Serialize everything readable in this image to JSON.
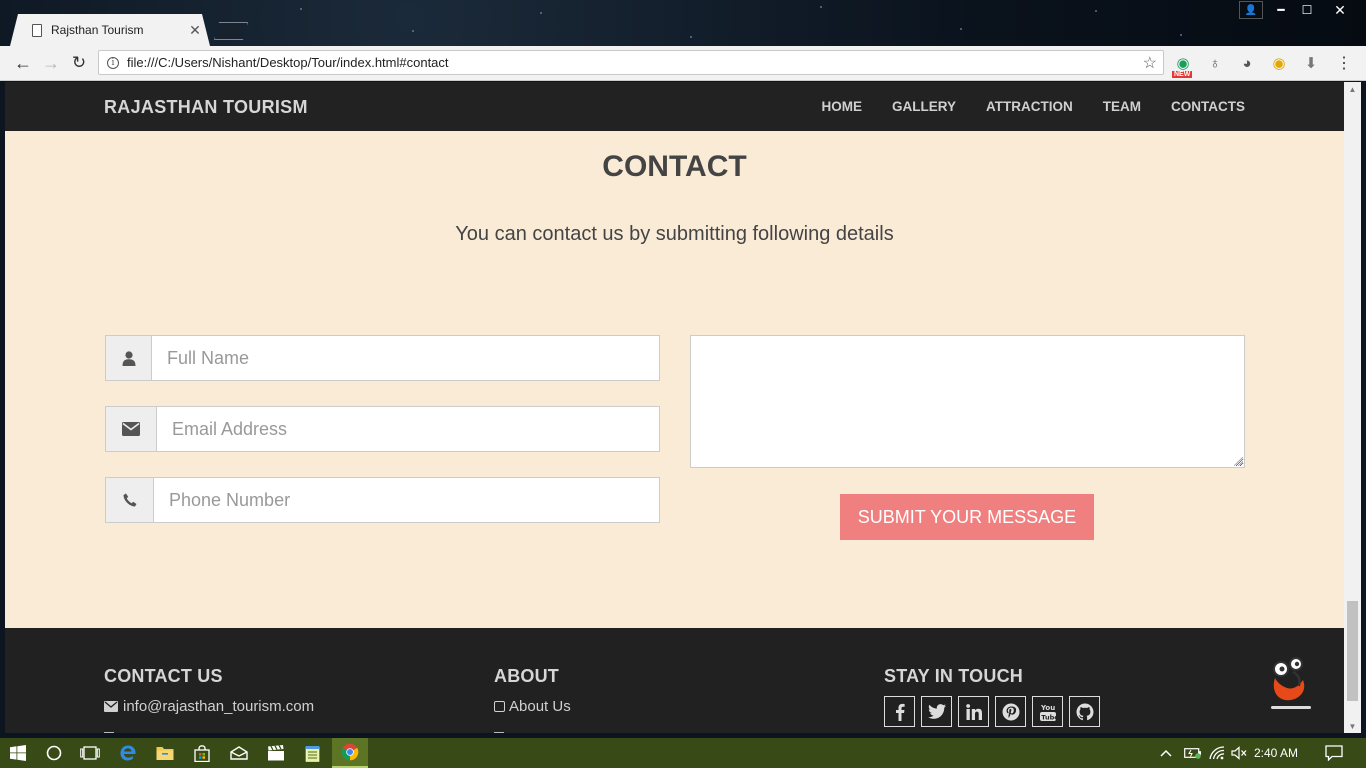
{
  "browser": {
    "tab_title": "Rajsthan Tourism",
    "url": "file:///C:/Users/Nishant/Desktop/Tour/index.html#contact",
    "extension_badge": "NEW"
  },
  "site": {
    "brand": "RAJASTHAN TOURISM",
    "nav": [
      "HOME",
      "GALLERY",
      "ATTRACTION",
      "TEAM",
      "CONTACTS"
    ]
  },
  "contact": {
    "title": "CONTACT",
    "subtitle": "You can contact us by submitting following details",
    "name_placeholder": "Full Name",
    "email_placeholder": "Email Address",
    "phone_placeholder": "Phone Number",
    "message_value": "",
    "submit_label": "SUBMIT YOUR MESSAGE"
  },
  "footer": {
    "contact_heading": "CONTACT US",
    "email": "info@rajasthan_tourism.com",
    "about_heading": "ABOUT",
    "about_link": "About Us",
    "stay_heading": "STAY IN TOUCH",
    "social_icons": [
      "facebook-icon",
      "twitter-icon",
      "linkedin-icon",
      "pinterest-icon",
      "youtube-icon",
      "github-icon"
    ]
  },
  "taskbar": {
    "time": "2:40 AM"
  },
  "colors": {
    "page_bg": "#faebd7",
    "nav_bg": "#222222",
    "submit_bg": "#f08080",
    "taskbar_bg": "#384a16"
  }
}
